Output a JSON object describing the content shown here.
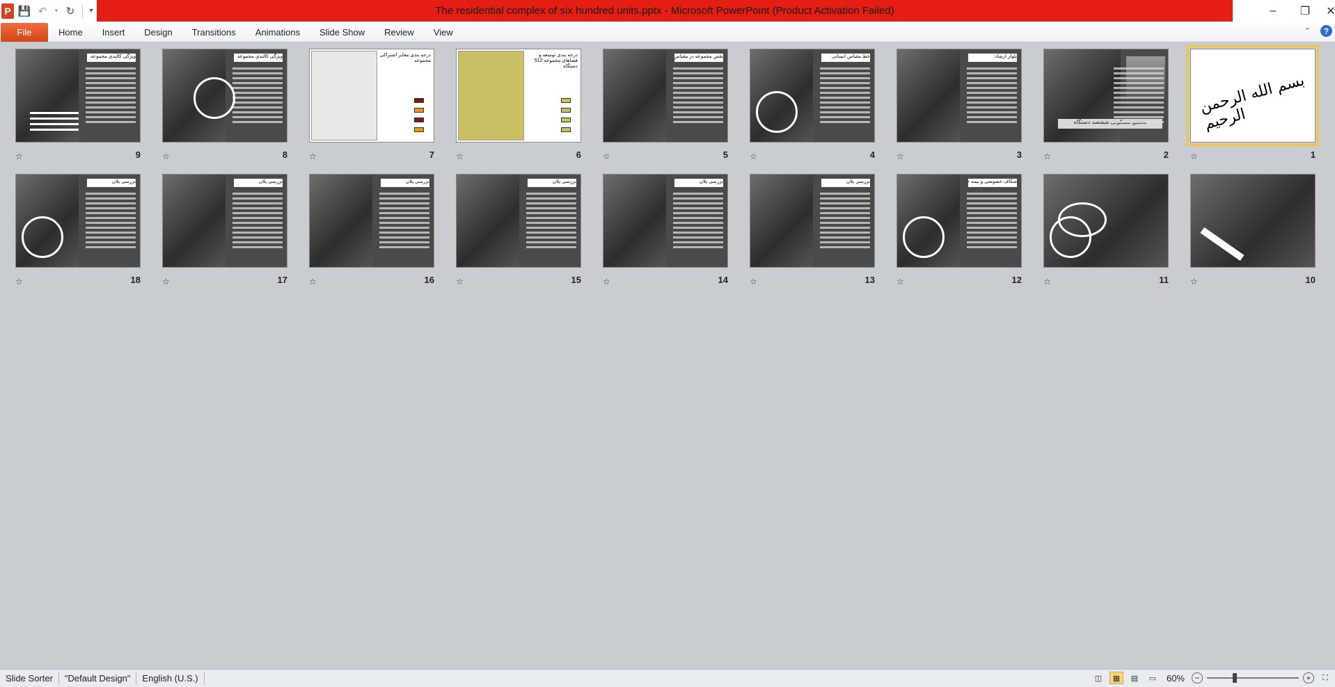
{
  "window": {
    "title": "The residential complex of six hundred units.pptx  -  Microsoft PowerPoint (Product Activation Failed)",
    "app_icon": "P"
  },
  "ribbon": {
    "file_label": "File",
    "tabs": [
      "Home",
      "Insert",
      "Design",
      "Transitions",
      "Animations",
      "Slide Show",
      "Review",
      "View"
    ]
  },
  "slides": [
    {
      "number": "1",
      "kind": "calligraphy",
      "selected": true
    },
    {
      "number": "2",
      "kind": "photos-building",
      "caption": "مجتمع مسکونی ششصد دستگاه"
    },
    {
      "number": "3",
      "kind": "photo-text",
      "heading": "بلوار ارشاد:"
    },
    {
      "number": "4",
      "kind": "photo-circle-text",
      "heading": "خط مقیاس انسانی"
    },
    {
      "number": "5",
      "kind": "photos-text",
      "heading": "نقش مجموعه در مقیاس شهری:"
    },
    {
      "number": "6",
      "kind": "map-yellow",
      "heading": "درجه بندی توسعه و فضاهای مجموعه 512 دستگاه"
    },
    {
      "number": "7",
      "kind": "map-white",
      "heading": "درجه بندی معابر اشتراکی مجموعه"
    },
    {
      "number": "8",
      "kind": "circles",
      "heading": "ویژگی کالبدی مجموعه"
    },
    {
      "number": "9",
      "kind": "bars",
      "heading": "ویژگی کالبدی مجموعه"
    },
    {
      "number": "10",
      "kind": "dark-diagonal"
    },
    {
      "number": "11",
      "kind": "dark-circles"
    },
    {
      "number": "12",
      "kind": "photo-circle-text",
      "heading": "شکاف خصوصی و نیمه خصوصی"
    },
    {
      "number": "13",
      "kind": "photos-text",
      "heading": "بررسی پلان"
    },
    {
      "number": "14",
      "kind": "photos-text",
      "heading": "بررسی پلان"
    },
    {
      "number": "15",
      "kind": "photos-text",
      "heading": "بررسی پلان"
    },
    {
      "number": "16",
      "kind": "photos-text",
      "heading": "بررسی پلان"
    },
    {
      "number": "17",
      "kind": "photos-text",
      "heading": "بررسی پلان"
    },
    {
      "number": "18",
      "kind": "photo-circle-text",
      "heading": "بررسی پلان"
    }
  ],
  "statusbar": {
    "view_name": "Slide Sorter",
    "theme": "\"Default Design\"",
    "language": "English (U.S.)",
    "zoom": "60%",
    "zoom_level": 0.6
  }
}
